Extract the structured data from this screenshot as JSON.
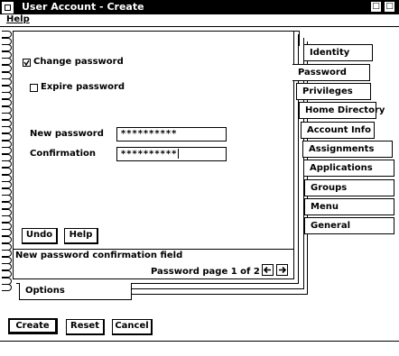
{
  "window": {
    "title": "User Account - Create",
    "minimize_glyph": "□",
    "maximize_glyph": "□"
  },
  "menu": {
    "help_label": "Help"
  },
  "form": {
    "change_password_label": "Change password",
    "change_password_checked": true,
    "expire_password_label": "Expire password",
    "expire_password_checked": false,
    "new_password_label": "New password",
    "new_password_value": "**********",
    "confirmation_label": "Confirmation",
    "confirmation_value": "**********"
  },
  "page_buttons": {
    "undo": "Undo",
    "help": "Help"
  },
  "page_status": {
    "message": "New password confirmation field",
    "page_indicator": "Password page 1 of 2"
  },
  "tabs": {
    "identity": "Identity",
    "password": "Password",
    "privileges": "Privileges",
    "home_directory": "Home Directory",
    "account_info": "Account Info",
    "assignments": "Assignments",
    "applications": "Applications",
    "groups": "Groups",
    "menu": "Menu",
    "general": "General",
    "options": "Options"
  },
  "bottom_buttons": {
    "create": "Create",
    "reset": "Reset",
    "cancel": "Cancel"
  },
  "icons": {
    "prev": "arrow-left-icon",
    "next": "arrow-right-icon",
    "system": "system-menu-icon"
  }
}
